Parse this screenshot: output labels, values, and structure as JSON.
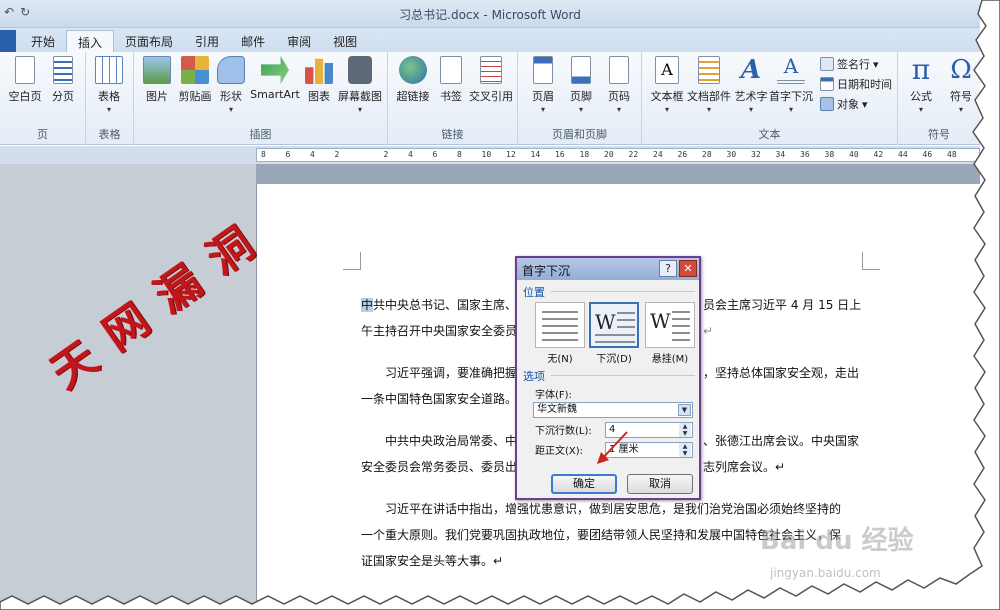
{
  "titlebar": {
    "window_title": "习总书记.docx - Microsoft Word",
    "qat_undo": "↶",
    "qat_redo": "↻"
  },
  "tabs": [
    {
      "label": "开始"
    },
    {
      "label": "插入",
      "active": true
    },
    {
      "label": "页面布局"
    },
    {
      "label": "引用"
    },
    {
      "label": "邮件"
    },
    {
      "label": "审阅"
    },
    {
      "label": "视图"
    }
  ],
  "ribbon": {
    "groups": {
      "pages": "页",
      "tables": "表格",
      "illustrations": "插图",
      "links": "链接",
      "header_footer": "页眉和页脚",
      "text": "文本",
      "symbols": "符号"
    },
    "buttons": {
      "blank_page": "空白页",
      "page_break": "分页",
      "table": "表格",
      "picture": "图片",
      "clip_art": "剪贴画",
      "shapes": "形状",
      "smartart": "SmartArt",
      "chart": "图表",
      "screenshot": "屏幕截图",
      "hyperlink": "超链接",
      "bookmark": "书签",
      "cross_ref": "交叉引用",
      "header": "页眉",
      "footer": "页脚",
      "page_number": "页码",
      "text_box": "文本框",
      "quick_parts": "文档部件",
      "wordart": "艺术字",
      "drop_cap": "首字下沉",
      "signature_line": "签名行",
      "date_time": "日期和时间",
      "object": "对象",
      "equation": "公式",
      "symbol": "符号"
    }
  },
  "ruler": {
    "ticks": [
      "8",
      "6",
      "4",
      "2",
      "",
      "2",
      "4",
      "6",
      "8",
      "10",
      "12",
      "14",
      "16",
      "18",
      "20",
      "22",
      "24",
      "26",
      "28",
      "30",
      "32",
      "34",
      "36",
      "38",
      "40",
      "42",
      "44",
      "46",
      "48"
    ]
  },
  "document": {
    "paragraphs": [
      {
        "line1_highlight": "中",
        "line1": "共中央总书记、国家主席、",
        "line1_tail": "员会主席习近平 4 月 15 日上",
        "line2": "午主持召开中央国家安全委员",
        "line2_mark": "↵"
      },
      {
        "line1": "　　习近平强调，要准确把握",
        "line1_tail": "，坚持总体国家安全观，走出",
        "line2": "一条中国特色国家安全道路。"
      },
      {
        "line1": "　　中共中央政治局常委、中",
        "line1_tail": "、张德江出席会议。中央国家",
        "line2": "安全委员会常务委员、委员出",
        "line2_tail": "志列席会议。↵"
      },
      {
        "line1": "　　习近平在讲话中指出，增强忧患意识，做到居安思危，是我们治党治国必须始终坚持的",
        "line2": "一个重大原则。我们党要巩固执政地位，要团结带领人民坚持和发展中国特色社会主义，保",
        "line3": "证国家安全是头等大事。↵"
      }
    ]
  },
  "watermark": {
    "chars": [
      "天",
      "网",
      "漏",
      "洞"
    ],
    "baidu_logo": "Bai du 经验",
    "baidu_url": "jingyan.baidu.com"
  },
  "dialog": {
    "title": "首字下沉",
    "help": "?",
    "close": "✕",
    "position_section": "位置",
    "positions": [
      {
        "label": "无(N)"
      },
      {
        "label": "下沉(D)",
        "selected": true
      },
      {
        "label": "悬挂(M)"
      }
    ],
    "options_section": "选项",
    "font_label": "字体(F):",
    "font_value": "华文新魏",
    "lines_label": "下沉行数(L):",
    "lines_value": "4",
    "distance_label": "距正文(X):",
    "distance_value": "1 厘米",
    "ok": "确定",
    "cancel": "取消"
  },
  "colors": {
    "accent": "#2a5fae",
    "dialog_border": "#6a3f8f",
    "watermark_red": "#c2161b"
  }
}
